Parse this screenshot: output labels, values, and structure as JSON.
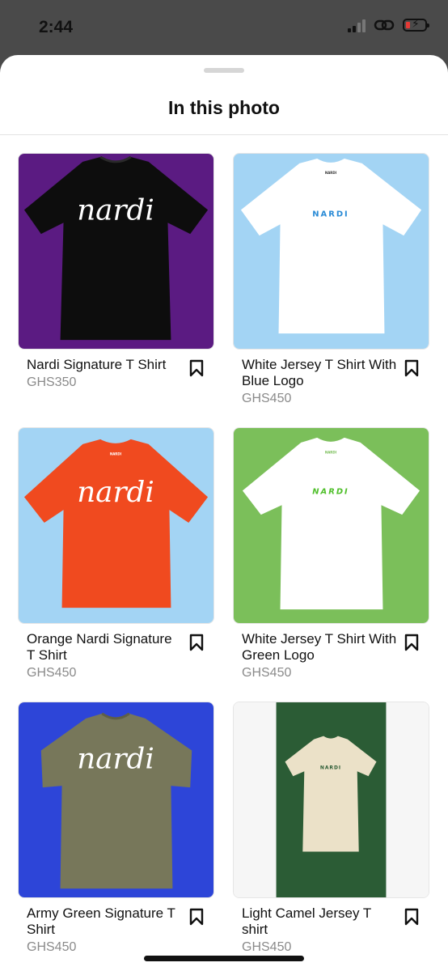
{
  "status": {
    "time": "2:44"
  },
  "sheet": {
    "title": "In this photo"
  },
  "colors": {
    "purple": "#5b1b82",
    "lightblue": "#a3d4f4",
    "green": "#7bbf5a",
    "royalblue": "#2d45d8",
    "darkgreen": "#2b5c35",
    "orange": "#f04a1f",
    "olive": "#77775a",
    "camel": "#ebe1c8"
  },
  "products": [
    {
      "title": "Nardi Signature T Shirt",
      "price": "GHS350",
      "logo": "nardi"
    },
    {
      "title": "White Jersey T Shirt With Blue Logo",
      "price": "GHS450",
      "logo": "NARDI"
    },
    {
      "title": "Orange Nardi Signature T Shirt",
      "price": "GHS450",
      "logo": "nardi"
    },
    {
      "title": "White Jersey T Shirt With Green Logo",
      "price": "GHS450",
      "logo": "NARDI"
    },
    {
      "title": "Army Green Signature T Shirt",
      "price": "GHS450",
      "logo": "nardi"
    },
    {
      "title": "Light Camel Jersey T shirt",
      "price": "GHS450",
      "logo": "NARDI"
    }
  ]
}
